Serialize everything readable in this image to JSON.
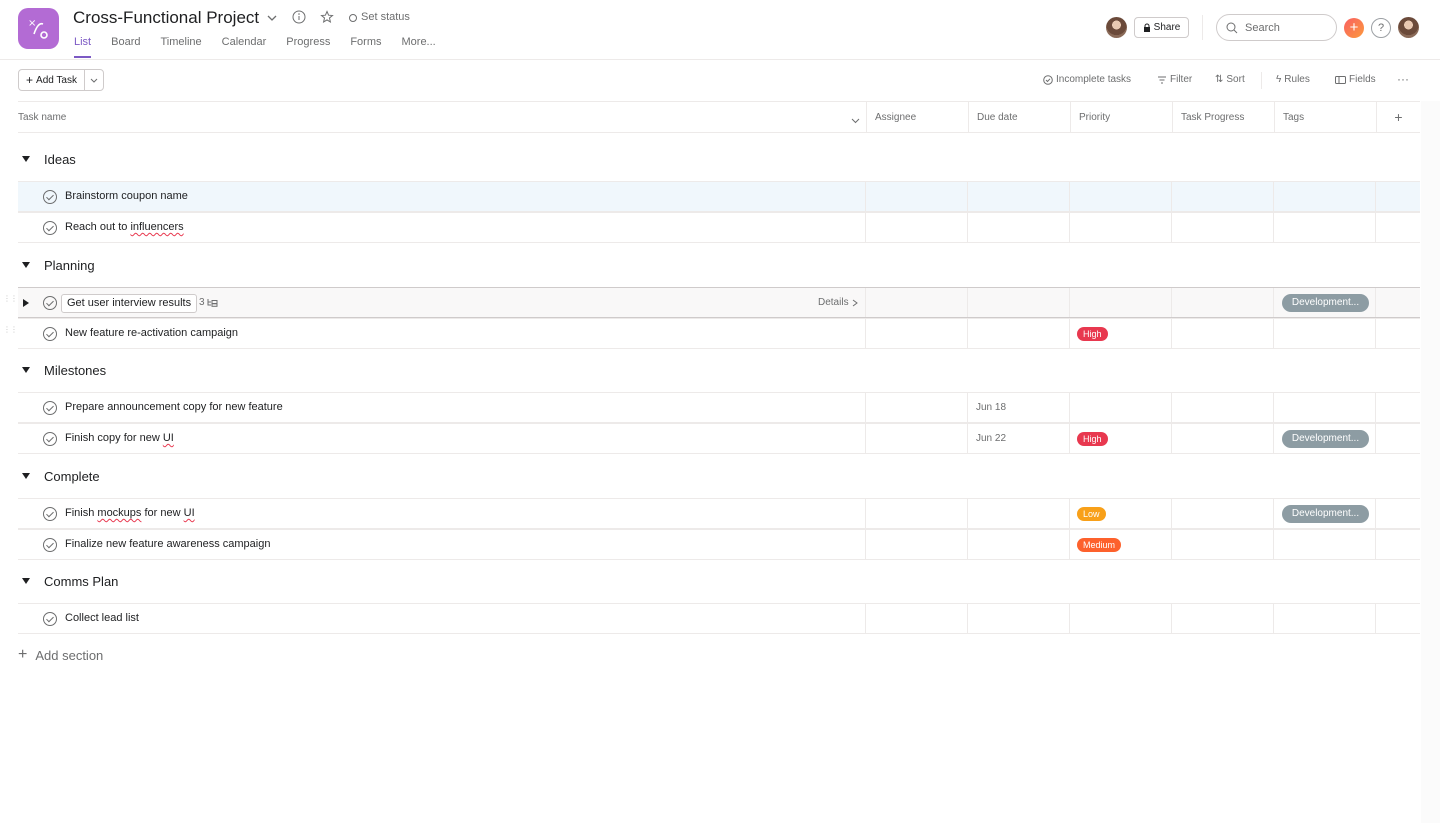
{
  "colors": {
    "brand": "#b36bd4",
    "active_tab": "#7c59c4",
    "high": "#e8384f",
    "low": "#f8a019",
    "medium": "#fd612c",
    "tag": "#8d9ca3"
  },
  "header": {
    "project_title": "Cross-Functional Project",
    "set_status": "Set status",
    "tabs": [
      {
        "label": "List",
        "active": true
      },
      {
        "label": "Board"
      },
      {
        "label": "Timeline"
      },
      {
        "label": "Calendar"
      },
      {
        "label": "Progress"
      },
      {
        "label": "Forms"
      },
      {
        "label": "More..."
      }
    ],
    "share_label": "Share",
    "search_placeholder": "Search",
    "help_label": "?"
  },
  "toolbar": {
    "add_task_label": "Add Task",
    "incomplete_tasks": "Incomplete tasks",
    "filter": "Filter",
    "sort": "Sort",
    "rules": "Rules",
    "fields": "Fields",
    "more": "···"
  },
  "columns": [
    "Task name",
    "Assignee",
    "Due date",
    "Priority",
    "Task Progress",
    "Tags"
  ],
  "sections": [
    {
      "name": "Ideas",
      "tasks": [
        {
          "name": "Brainstorm coupon name"
        },
        {
          "name_pre": "Reach out to ",
          "name_sq": "influencers"
        }
      ]
    },
    {
      "name": "Planning",
      "tasks": [
        {
          "name": "Get user interview results",
          "subtasks": "3",
          "details": "Details",
          "tag": "Development..."
        },
        {
          "name": "New feature re-activation campaign",
          "priority": "High"
        }
      ]
    },
    {
      "name": "Milestones",
      "tasks": [
        {
          "name": "Prepare announcement copy for new feature",
          "due": "Jun 18"
        },
        {
          "name_pre": "Finish copy for new ",
          "name_sq": "UI",
          "due": "Jun 22",
          "priority": "High",
          "tag": "Development..."
        }
      ]
    },
    {
      "name": "Complete",
      "tasks": [
        {
          "name_pre": "Finish ",
          "name_sq": "mockups",
          "name_post": " for new ",
          "name_sq2": "UI",
          "priority": "Low",
          "tag": "Development..."
        },
        {
          "name": "Finalize new feature awareness campaign",
          "priority": "Medium"
        }
      ]
    },
    {
      "name": "Comms Plan",
      "tasks": [
        {
          "name": "Collect lead list"
        }
      ]
    }
  ],
  "add_section": "Add section"
}
